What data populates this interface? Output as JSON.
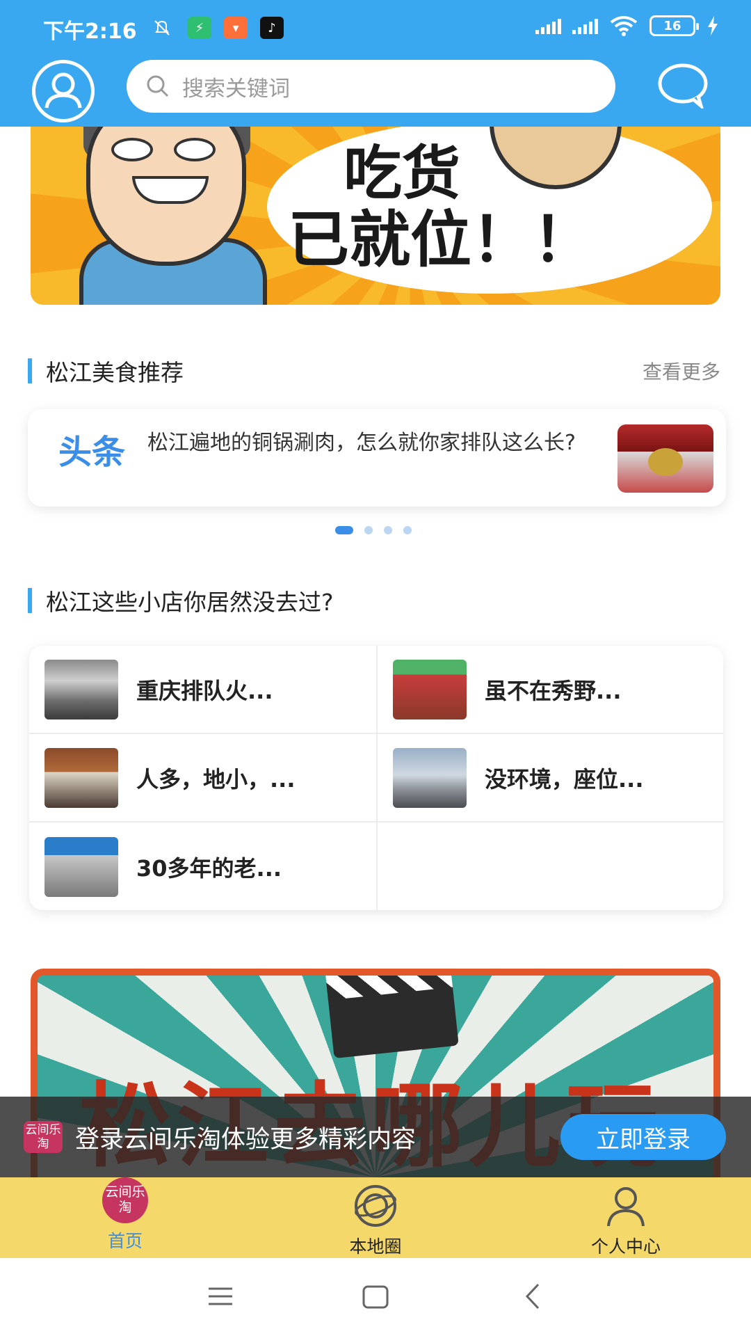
{
  "status": {
    "time": "下午2:16",
    "battery": "16"
  },
  "header": {
    "search_placeholder": "搜索关键词"
  },
  "banner1": {
    "line1": "吃货",
    "line2": "已就位！！"
  },
  "food_section": {
    "title": "松江美食推荐",
    "more": "查看更多",
    "headline_tag": "头条",
    "headline_text": "松江遍地的铜锅涮肉，怎么就你家排队这么长?"
  },
  "shops_section": {
    "title": "松江这些小店你居然没去过?",
    "items": [
      {
        "name": "重庆排队火..."
      },
      {
        "name": "虽不在秀野..."
      },
      {
        "name": "人多，地小，..."
      },
      {
        "name": "没环境，座位..."
      },
      {
        "name": "30多年的老..."
      }
    ]
  },
  "banner2": {
    "text": "松江去哪儿玩"
  },
  "login_prompt": {
    "logo": "云间乐淘",
    "message": "登录云间乐淘体验更多精彩内容",
    "button": "立即登录"
  },
  "tabs": [
    {
      "label": "首页",
      "logo": "云间乐淘",
      "icon": "home-logo-icon",
      "active": true
    },
    {
      "label": "本地圈",
      "icon": "planet-icon",
      "active": false
    },
    {
      "label": "个人中心",
      "icon": "person-icon",
      "active": false
    }
  ],
  "colors": {
    "primary": "#3aa8f0",
    "accent": "#3a8ee8",
    "tabbar": "#f5d86a",
    "brand": "#c6355f"
  }
}
